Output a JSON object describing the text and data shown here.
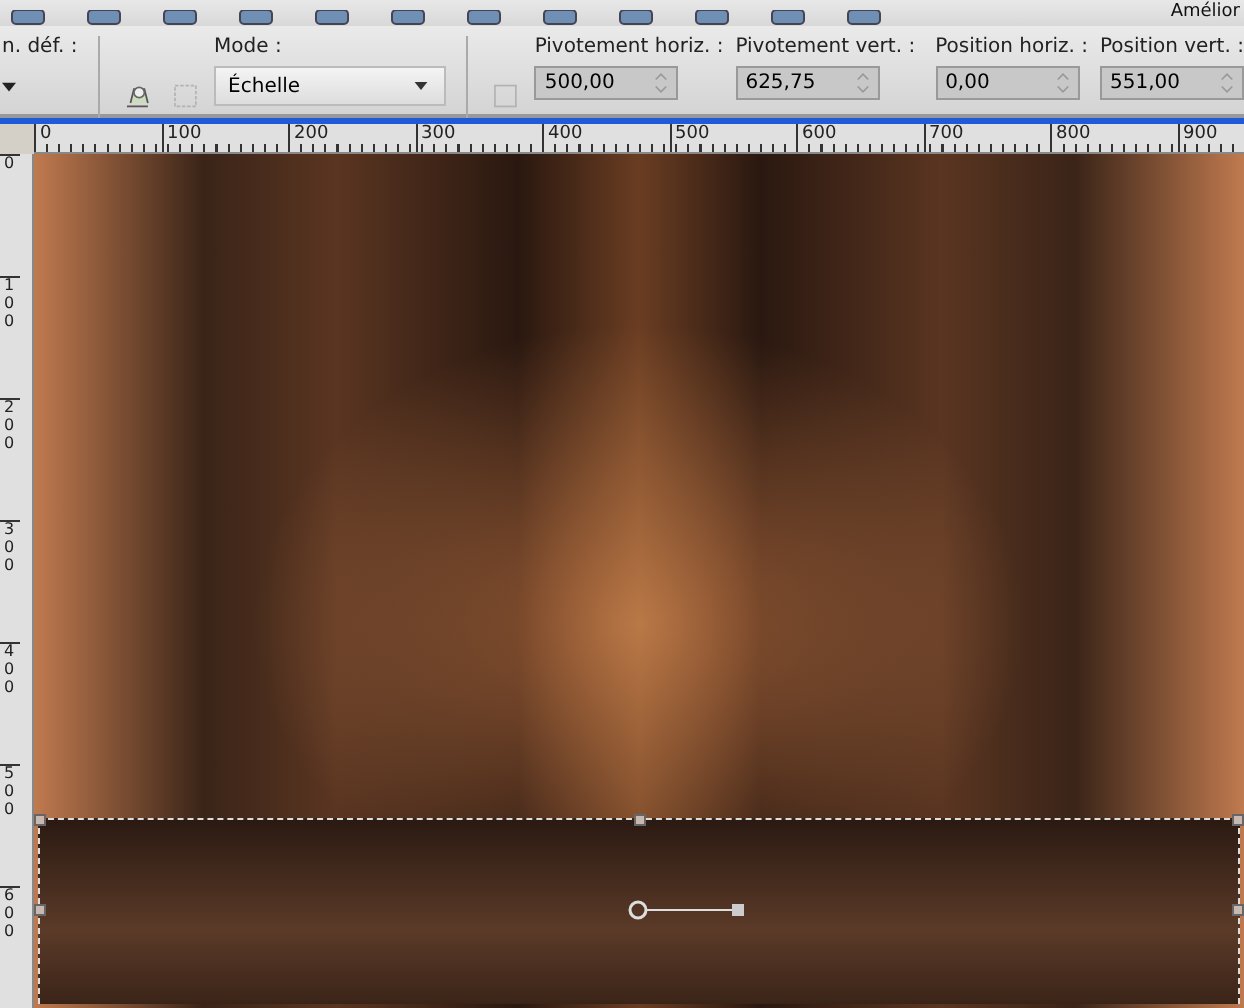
{
  "top_toolbar": {
    "label": "Amélior"
  },
  "tool_options": {
    "preset_label": "n. déf. :",
    "mode": {
      "label": "Mode :",
      "value": "Échelle"
    },
    "fields": [
      {
        "label": "Pivotement horiz. :",
        "value": "500,00"
      },
      {
        "label": "Pivotement vert. :",
        "value": "625,75"
      },
      {
        "label": "Position horiz. :",
        "value": "0,00"
      },
      {
        "label": "Position vert. :",
        "value": "551,00"
      }
    ]
  },
  "rulers": {
    "horizontal": [
      "0",
      "100",
      "200",
      "300",
      "400",
      "500",
      "600",
      "700",
      "800",
      "900"
    ],
    "vertical": [
      "0",
      "100",
      "200",
      "300",
      "400",
      "500",
      "600"
    ]
  }
}
